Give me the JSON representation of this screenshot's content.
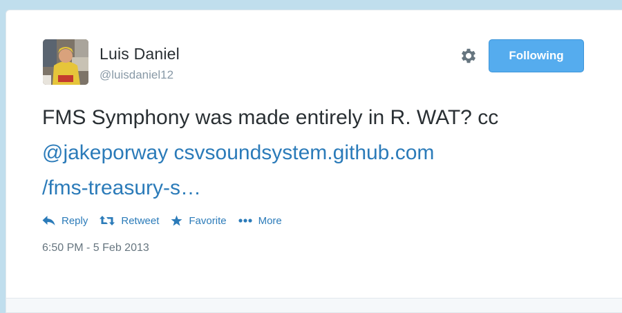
{
  "author": {
    "name": "Luis Daniel",
    "handle": "@luisdaniel12"
  },
  "follow_button": {
    "label": "Following"
  },
  "tweet": {
    "text_plain": "FMS Symphony was made entirely in R. WAT? cc",
    "mention": "@jakeporway",
    "link_line1": "csvsoundsystem.github.com",
    "link_line2": "/fms-treasury-s…"
  },
  "actions": {
    "reply": "Reply",
    "retweet": "Retweet",
    "favorite": "Favorite",
    "more": "More"
  },
  "timestamp": "6:50 PM - 5 Feb 2013",
  "colors": {
    "link": "#2b7bb9",
    "follow_button": "#55acee",
    "background": "#c0deed"
  },
  "icons": [
    "gear-icon",
    "reply-icon",
    "retweet-icon",
    "favorite-icon",
    "more-icon"
  ]
}
